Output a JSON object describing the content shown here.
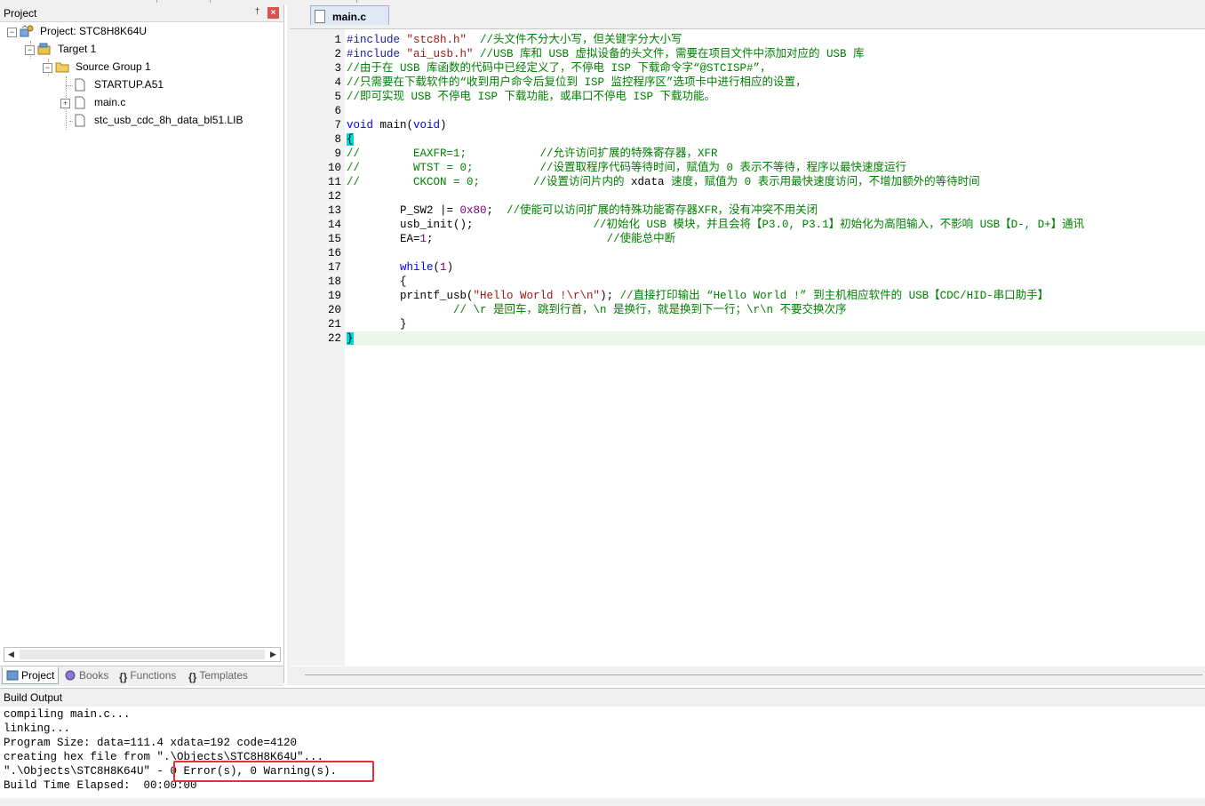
{
  "project_panel": {
    "title": "Project",
    "pin_glyph": "†",
    "close_glyph": "×",
    "tree": {
      "project": "Project: STC8H8K64U",
      "target": "Target 1",
      "group": "Source Group 1",
      "files": [
        "STARTUP.A51",
        "main.c",
        "stc_usb_cdc_8h_data_bl51.LIB"
      ]
    },
    "tabs": [
      "Project",
      "Books",
      "Functions",
      "Templates"
    ]
  },
  "editor": {
    "file_tab": "main.c",
    "current_line": 22,
    "lines": [
      {
        "n": "1",
        "segs": [
          {
            "c": "pp",
            "t": "#include "
          },
          {
            "c": "str",
            "t": "\"stc8h.h\""
          },
          {
            "c": "cm",
            "t": "  //头文件不分大小写，但关键字分大小写"
          }
        ]
      },
      {
        "n": "2",
        "segs": [
          {
            "c": "pp",
            "t": "#include "
          },
          {
            "c": "str",
            "t": "\"ai_usb.h\""
          },
          {
            "c": "cm",
            "t": " //USB 库和 USB 虚拟设备的头文件，需要在项目文件中添加对应的 USB 库"
          }
        ]
      },
      {
        "n": "3",
        "segs": [
          {
            "c": "cm",
            "t": "//由于在 USB 库函数的代码中已经定义了，不停电 ISP 下载命令字“@STCISP#”，"
          }
        ]
      },
      {
        "n": "4",
        "segs": [
          {
            "c": "cm",
            "t": "//只需要在下载软件的“收到用户命令后复位到 ISP 监控程序区”选项卡中进行相应的设置，"
          }
        ]
      },
      {
        "n": "5",
        "segs": [
          {
            "c": "cm",
            "t": "//即可实现 USB 不停电 ISP 下载功能，或串口不停电 ISP 下载功能。"
          }
        ]
      },
      {
        "n": "6",
        "segs": []
      },
      {
        "n": "7",
        "segs": [
          {
            "c": "kw",
            "t": "void"
          },
          {
            "c": "",
            "t": " main("
          },
          {
            "c": "kw",
            "t": "void"
          },
          {
            "c": "",
            "t": ")"
          }
        ]
      },
      {
        "n": "8",
        "segs": [
          {
            "c": "brace-hl",
            "t": "{"
          }
        ]
      },
      {
        "n": "9",
        "segs": [
          {
            "c": "cm",
            "t": "//        EAXFR=1;           //允许访问扩展的特殊寄存器，XFR"
          }
        ]
      },
      {
        "n": "10",
        "segs": [
          {
            "c": "cm",
            "t": "//        WTST = 0;          //设置取程序代码等待时间，赋值为 0 表示不等待，程序以最快速度运行"
          }
        ]
      },
      {
        "n": "11",
        "segs": [
          {
            "c": "cm",
            "t": "//        CKCON = 0;        //设置访问片内的 "
          },
          {
            "c": "",
            "t": "xdata"
          },
          {
            "c": "cm",
            "t": " 速度，赋值为 0 表示用最快速度访问，不增加额外的等待时间"
          }
        ]
      },
      {
        "n": "12",
        "segs": []
      },
      {
        "n": "13",
        "segs": [
          {
            "c": "",
            "t": "        P_SW2 |= "
          },
          {
            "c": "num",
            "t": "0x80"
          },
          {
            "c": "",
            "t": ";  "
          },
          {
            "c": "cm",
            "t": "//使能可以访问扩展的特殊功能寄存器XFR，没有冲突不用关闭"
          }
        ]
      },
      {
        "n": "14",
        "segs": [
          {
            "c": "",
            "t": "        usb_init();                  "
          },
          {
            "c": "cm",
            "t": "//初始化 USB 模块，并且会将【P3.0, P3.1】初始化为高阻输入，不影响 USB【D-, D+】通讯"
          }
        ]
      },
      {
        "n": "15",
        "segs": [
          {
            "c": "",
            "t": "        EA="
          },
          {
            "c": "num",
            "t": "1"
          },
          {
            "c": "",
            "t": ";                          "
          },
          {
            "c": "cm",
            "t": "//使能总中断"
          }
        ]
      },
      {
        "n": "16",
        "segs": []
      },
      {
        "n": "17",
        "segs": [
          {
            "c": "",
            "t": "        "
          },
          {
            "c": "kw",
            "t": "while"
          },
          {
            "c": "",
            "t": "("
          },
          {
            "c": "num",
            "t": "1"
          },
          {
            "c": "",
            "t": ")"
          }
        ]
      },
      {
        "n": "18",
        "segs": [
          {
            "c": "",
            "t": "        {"
          }
        ]
      },
      {
        "n": "19",
        "segs": [
          {
            "c": "",
            "t": "        printf_usb("
          },
          {
            "c": "str",
            "t": "\"Hello World !\\r\\n\""
          },
          {
            "c": "",
            "t": "); "
          },
          {
            "c": "cm",
            "t": "//直接打印输出 “Hello World !” 到主机相应软件的 USB【CDC/HID-串口助手】"
          }
        ]
      },
      {
        "n": "20",
        "segs": [
          {
            "c": "cm",
            "t": "                // \\r 是回车，跳到行首，\\n 是换行，就是换到下一行；\\r\\n 不要交换次序"
          }
        ]
      },
      {
        "n": "21",
        "segs": [
          {
            "c": "",
            "t": "        }"
          }
        ]
      },
      {
        "n": "22",
        "segs": [
          {
            "c": "brace-hl",
            "t": "}"
          }
        ]
      }
    ]
  },
  "build_output": {
    "title": "Build Output",
    "lines": [
      "compiling main.c...",
      "linking...",
      "Program Size: data=111.4 xdata=192 code=4120",
      "creating hex file from \".\\Objects\\STC8H8K64U\"...",
      "\".\\Objects\\STC8H8K64U\" - 0 Error(s), 0 Warning(s).",
      "Build Time Elapsed:  00:00:00"
    ],
    "highlight_color": "#e0303a"
  },
  "colors": {
    "comment": "#008000",
    "keyword": "#0000ff",
    "string": "#a31515",
    "number": "#800080",
    "brace_highlight": "#00d8d8",
    "current_line": "#e8f7ea"
  }
}
